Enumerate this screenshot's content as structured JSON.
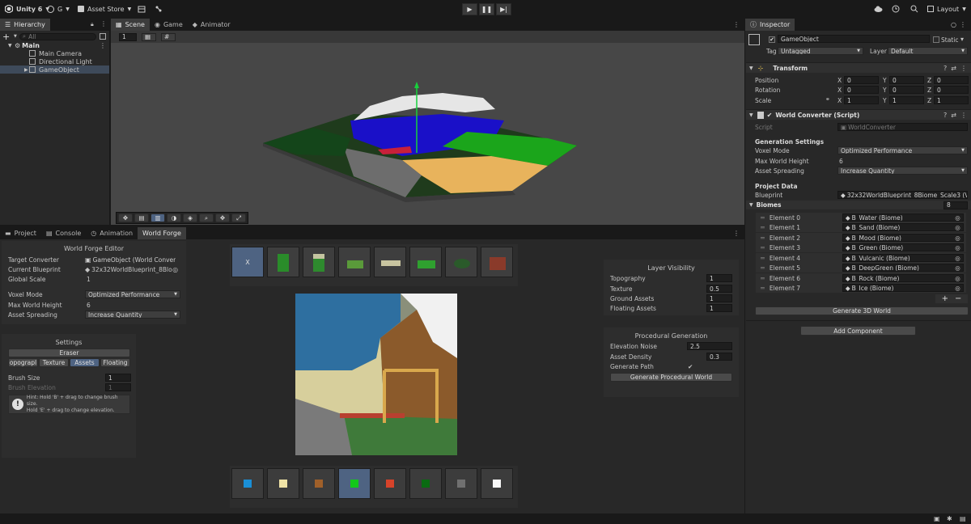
{
  "topbar": {
    "product": "Unity 6",
    "account": "G",
    "asset_store": "Asset Store",
    "layout": "Layout"
  },
  "hierarchy": {
    "tab": "Hierarchy",
    "search_placeholder": "All",
    "scene": "Main",
    "items": [
      "Main Camera",
      "Directional Light",
      "GameObject"
    ]
  },
  "scene_tabs": [
    "Scene",
    "Game",
    "Animator"
  ],
  "scene_toolbar": {
    "scale_value": "1"
  },
  "bottom_tabs": [
    "Project",
    "Console",
    "Animation",
    "World Forge"
  ],
  "forge": {
    "title": "World Forge Editor",
    "target_label": "Target Converter",
    "target_value": "GameObject (World Conver",
    "blueprint_label": "Current Blueprint",
    "blueprint_value": "32x32WorldBlueprint_8Blom",
    "scale_label": "Global Scale",
    "scale_value": "1",
    "voxel_label": "Voxel Mode",
    "voxel_value": "Optimized Performance",
    "height_label": "Max World Height",
    "height_value": "6",
    "spread_label": "Asset Spreading",
    "spread_value": "Increase Quantity"
  },
  "settings": {
    "title": "Settings",
    "eraser": "Eraser",
    "tabs": [
      "opograpl",
      "Texture",
      "Assets",
      "Floating"
    ],
    "brush_size_label": "Brush Size",
    "brush_size_value": "1",
    "brush_elev_label": "Brush Elevation",
    "brush_elev_value": "1",
    "hint_line1": "Hint: Hold 'B' + drag to change brush size.",
    "hint_line2": "Hold 'E' + drag to change elevation."
  },
  "asset_tiles": {
    "first": "X"
  },
  "palette": [
    "#1a8fd6",
    "#efe3a6",
    "#a0602a",
    "#13c81a",
    "#d6432a",
    "#0a6b12",
    "#707070",
    "#f8f8f8"
  ],
  "layer_visibility": {
    "title": "Layer Visibility",
    "rows": [
      {
        "label": "Topography",
        "value": "1"
      },
      {
        "label": "Texture",
        "value": "0.5"
      },
      {
        "label": "Ground Assets",
        "value": "1"
      },
      {
        "label": "Floating Assets",
        "value": "1"
      }
    ]
  },
  "procedural": {
    "title": "Procedural Generation",
    "noise_label": "Elevation Noise",
    "noise_value": "2.5",
    "density_label": "Asset Density",
    "density_value": "0.3",
    "path_label": "Generate Path",
    "path_value": "✔",
    "button": "Generate Procedural World"
  },
  "inspector": {
    "tab": "Inspector",
    "object_name": "GameObject",
    "static_label": "Static",
    "tag_label": "Tag",
    "tag_value": "Untagged",
    "layer_label": "Layer",
    "layer_value": "Default",
    "transform_title": "Transform",
    "position_label": "Position",
    "rotation_label": "Rotation",
    "scale_label": "Scale",
    "axes": [
      "X",
      "Y",
      "Z"
    ],
    "position": [
      "0",
      "0",
      "0"
    ],
    "rotation": [
      "0",
      "0",
      "0"
    ],
    "scale": [
      "1",
      "1",
      "1"
    ],
    "script_title": "World Converter (Script)",
    "script_label": "Script",
    "script_value": "WorldConverter",
    "gen_settings": "Generation Settings",
    "voxel_label": "Voxel Mode",
    "voxel_value": "Optimized Performance",
    "height_label": "Max World Height",
    "height_value": "6",
    "spread_label": "Asset Spreading",
    "spread_value": "Increase Quantity",
    "project_data": "Project Data",
    "blueprint_label": "Blueprint",
    "blueprint_value": "32x32WorldBlueprint_8Biome_Scale3 (V",
    "biomes_label": "Biomes",
    "biomes_count": "8",
    "elements": [
      {
        "label": "Element 0",
        "value": "B_Water (Biome)"
      },
      {
        "label": "Element 1",
        "value": "B_Sand (Biome)"
      },
      {
        "label": "Element 2",
        "value": "B_Mood (Biome)"
      },
      {
        "label": "Element 3",
        "value": "B_Green (Biome)"
      },
      {
        "label": "Element 4",
        "value": "B_Vulcanic (Biome)"
      },
      {
        "label": "Element 5",
        "value": "B_DeepGreen (Biome)"
      },
      {
        "label": "Element 6",
        "value": "B_Rock (Biome)"
      },
      {
        "label": "Element 7",
        "value": "B_Ice (Biome)"
      }
    ],
    "generate_button": "Generate 3D World",
    "add_component": "Add Component"
  }
}
